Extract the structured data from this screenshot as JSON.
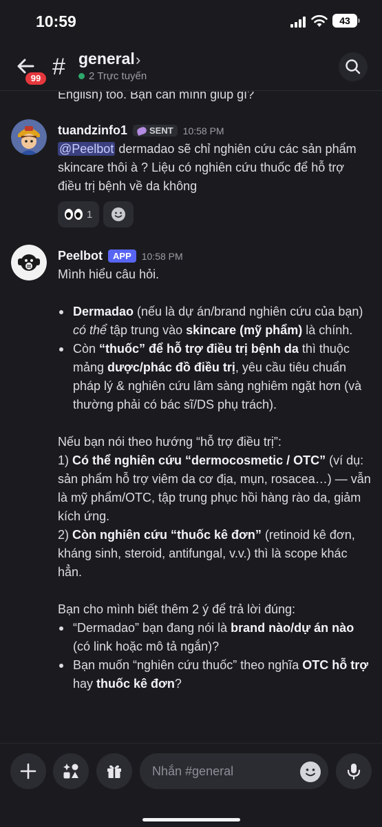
{
  "status_bar": {
    "time": "10:59",
    "battery": "43"
  },
  "header": {
    "unread_count": "99",
    "channel_name": "general",
    "online": "2 Trực tuyến"
  },
  "previous_line": "English) too. Bạn cần mình giúp gì?",
  "messages": [
    {
      "author": "tuandzinfo1",
      "tag": "SENT",
      "time": "10:58 PM",
      "mention": "@Peelbot",
      "text": " dermadao sẽ chỉ nghiên cứu các sản phẩm skincare thôi à ? Liệu có nghiên cứu thuốc để hỗ trợ điều trị bệnh về da không",
      "reaction_count": "1"
    },
    {
      "author": "Peelbot",
      "tag": "APP",
      "time": "10:58 PM",
      "intro": "Mình hiểu câu hỏi.",
      "b1_bold": "Dermadao",
      "b1_a": " (nếu là dự án/brand nghiên cứu của bạn) ",
      "b1_italic": "có thể",
      "b1_b": " tập trung vào ",
      "b1_bold2": "skincare (mỹ phẩm)",
      "b1_c": " là chính.",
      "b2_a": "Còn ",
      "b2_bold": "“thuốc” để hỗ trợ điều trị bệnh da",
      "b2_b": " thì thuộc mảng ",
      "b2_bold2": "dược/phác đồ điều trị",
      "b2_c": ", yêu cầu tiêu chuẩn pháp lý & nghiên cứu lâm sàng nghiêm ngặt hơn (và thường phải có bác sĩ/DS phụ trách).",
      "p2_intro": "Nếu bạn nói theo hướng “hỗ trợ điều trị”:",
      "p2_1_num": "1) ",
      "p2_1_bold": "Có thể nghiên cứu “dermocosmetic / OTC”",
      "p2_1_text": " (ví dụ: sản phẩm hỗ trợ viêm da cơ địa, mụn, rosacea…) — vẫn là mỹ phẩm/OTC, tập trung phục hồi hàng rào da, giảm kích ứng.",
      "p2_2_num": "2) ",
      "p2_2_bold": "Còn nghiên cứu “thuốc kê đơn”",
      "p2_2_text": " (retinoid kê đơn, kháng sinh, steroid, antifungal, v.v.) thì là scope khác hẳn.",
      "p3_intro": "Bạn cho mình biết thêm 2 ý để trả lời đúng:",
      "q1_a": "“Dermadao” bạn đang nói là ",
      "q1_bold": "brand nào/dự án nào",
      "q1_b": " (có link hoặc mô tả ngắn)?",
      "q2_a": "Bạn muốn “nghiên cứu thuốc” theo nghĩa ",
      "q2_bold": "OTC hỗ trợ",
      "q2_b": " hay ",
      "q2_bold2": "thuốc kê đơn",
      "q2_c": "?"
    }
  ],
  "composer": {
    "placeholder": "Nhắn #general"
  }
}
